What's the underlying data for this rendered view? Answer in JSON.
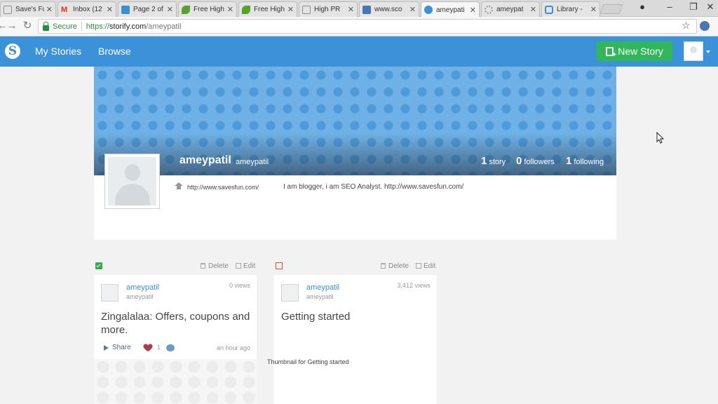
{
  "browser": {
    "tabs": [
      {
        "label": "Save's Fu",
        "favicon_color": "#8c8c8c"
      },
      {
        "label": "Inbox (12",
        "favicon_color": "#d93025"
      },
      {
        "label": "Page 2 of",
        "favicon_color": "#3b8fd4"
      },
      {
        "label": "Free High",
        "favicon_color": "#5aa02c"
      },
      {
        "label": "Free High",
        "favicon_color": "#5aa02c"
      },
      {
        "label": "High PR ",
        "favicon_color": "#8c8c8c"
      },
      {
        "label": "www.sco",
        "favicon_color": "#4a76b5"
      },
      {
        "label": "ameypati",
        "favicon_color": "#3b92d8"
      },
      {
        "label": "ameypat",
        "favicon_color": "#999999"
      },
      {
        "label": "Library -",
        "favicon_color": "#3b8fd4"
      }
    ],
    "active_tab": 7,
    "secure_label": "Secure",
    "url_scheme": "https://",
    "url_host": "storify.com",
    "url_path": "/ameypatil"
  },
  "app": {
    "nav": {
      "my_stories": "My Stories",
      "browse": "Browse"
    },
    "new_story_label": "New Story",
    "brand_color": "#3b92d8",
    "new_story_color": "#31b75a"
  },
  "profile": {
    "display_name": "ameypatil",
    "username": "ameypatil",
    "stats": {
      "stories_count": "1",
      "stories_label": "story",
      "followers_count": "0",
      "followers_label": "followers",
      "following_count": "1",
      "following_label": "following"
    },
    "website": "http://www.savesfun.com/",
    "bio": "I am blogger, i am SEO Analyst. http://www.savesfun.com/"
  },
  "stories": [
    {
      "delete_label": "Delete",
      "edit_label": "Edit",
      "author": "ameypatil",
      "handle": "ameypatil",
      "views": "0 views",
      "title": "Zingalalaa: Offers, coupons and more.",
      "share_label": "Share",
      "likes": "1",
      "time": "an hour ago",
      "status": "published"
    },
    {
      "delete_label": "Delete",
      "edit_label": "Edit",
      "author": "ameypatil",
      "handle": "ameypatil",
      "views": "3,412 views",
      "title": "Getting started",
      "thumbnail_alt": "Thumbnail for Getting started",
      "status": "draft"
    }
  ]
}
